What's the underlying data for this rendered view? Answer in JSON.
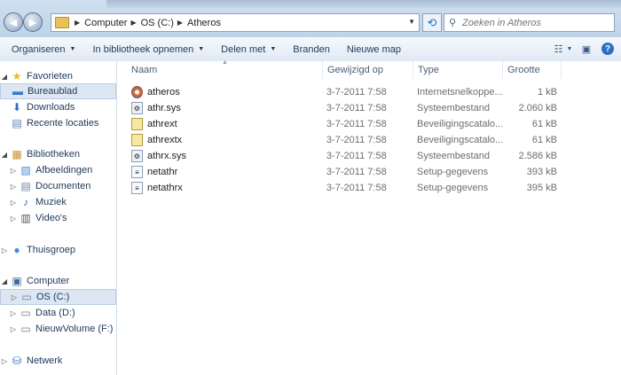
{
  "address": {
    "crumbs": [
      "Computer",
      "OS (C:)",
      "Atheros"
    ]
  },
  "search": {
    "placeholder": "Zoeken in Atheros"
  },
  "toolbar": {
    "items": [
      {
        "label": "Organiseren",
        "dropdown": true
      },
      {
        "label": "In bibliotheek opnemen",
        "dropdown": true
      },
      {
        "label": "Delen met",
        "dropdown": true
      },
      {
        "label": "Branden",
        "dropdown": false
      },
      {
        "label": "Nieuwe map",
        "dropdown": false
      }
    ]
  },
  "nav": {
    "favorieten": "Favorieten",
    "bureaublad": "Bureaublad",
    "downloads": "Downloads",
    "recente": "Recente locaties",
    "bibliotheken": "Bibliotheken",
    "afbeeldingen": "Afbeeldingen",
    "documenten": "Documenten",
    "muziek": "Muziek",
    "videos": "Video's",
    "thuisgroep": "Thuisgroep",
    "computer": "Computer",
    "os": "OS (C:)",
    "data": "Data (D:)",
    "nieuw": "NieuwVolume (F:)",
    "netwerk": "Netwerk"
  },
  "columns": {
    "name": "Naam",
    "date": "Gewijzigd op",
    "type": "Type",
    "size": "Grootte"
  },
  "files": [
    {
      "name": "atheros",
      "date": "3-7-2011 7:58",
      "type": "Internetsnelkoppe...",
      "size": "1 kB",
      "icon": "internet-shortcut-icon"
    },
    {
      "name": "athr.sys",
      "date": "3-7-2011 7:58",
      "type": "Systeembestand",
      "size": "2.060 kB",
      "icon": "system-file-icon"
    },
    {
      "name": "athrext",
      "date": "3-7-2011 7:58",
      "type": "Beveiligingscatalo...",
      "size": "61 kB",
      "icon": "security-catalog-icon"
    },
    {
      "name": "athrextx",
      "date": "3-7-2011 7:58",
      "type": "Beveiligingscatalo...",
      "size": "61 kB",
      "icon": "security-catalog-icon"
    },
    {
      "name": "athrx.sys",
      "date": "3-7-2011 7:58",
      "type": "Systeembestand",
      "size": "2.586 kB",
      "icon": "system-file-icon"
    },
    {
      "name": "netathr",
      "date": "3-7-2011 7:58",
      "type": "Setup-gegevens",
      "size": "393 kB",
      "icon": "setup-info-icon"
    },
    {
      "name": "netathrx",
      "date": "3-7-2011 7:58",
      "type": "Setup-gegevens",
      "size": "395 kB",
      "icon": "setup-info-icon"
    }
  ]
}
